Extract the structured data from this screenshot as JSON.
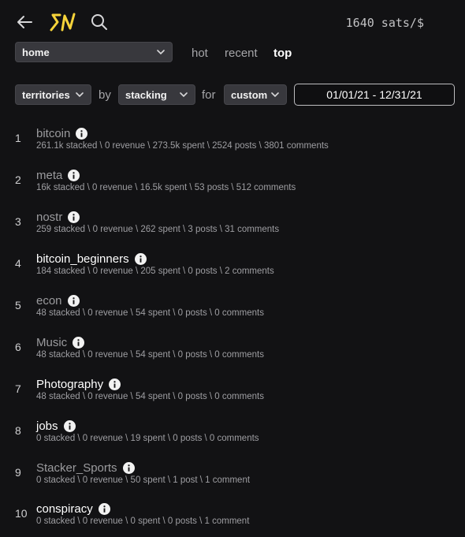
{
  "header": {
    "sats": "1640 sats/$"
  },
  "filters": {
    "sub_select": "home",
    "sort_tabs": [
      "hot",
      "recent",
      "top"
    ],
    "active_tab": "top",
    "what_select": "territories",
    "by_label": "by",
    "by_select": "stacking",
    "for_label": "for",
    "when_select": "custom",
    "date_range": "01/01/21 - 12/31/21"
  },
  "territories": [
    {
      "rank": "1",
      "name": "bitcoin",
      "stats": "261.1k stacked \\ 0 revenue \\ 273.5k spent \\ 2524 posts \\ 3801 comments",
      "style": "dim"
    },
    {
      "rank": "2",
      "name": "meta",
      "stats": "16k stacked \\ 0 revenue \\ 16.5k spent \\ 53 posts \\ 512 comments",
      "style": "dim"
    },
    {
      "rank": "3",
      "name": "nostr",
      "stats": "259 stacked \\ 0 revenue \\ 262 spent \\ 3 posts \\ 31 comments",
      "style": "dim"
    },
    {
      "rank": "4",
      "name": "bitcoin_beginners",
      "stats": "184 stacked \\ 0 revenue \\ 205 spent \\ 0 posts \\ 2 comments",
      "style": "bright"
    },
    {
      "rank": "5",
      "name": "econ",
      "stats": "48 stacked \\ 0 revenue \\ 54 spent \\ 0 posts \\ 0 comments",
      "style": "dim"
    },
    {
      "rank": "6",
      "name": "Music",
      "stats": "48 stacked \\ 0 revenue \\ 54 spent \\ 0 posts \\ 0 comments",
      "style": "dim"
    },
    {
      "rank": "7",
      "name": "Photography",
      "stats": "48 stacked \\ 0 revenue \\ 54 spent \\ 0 posts \\ 0 comments",
      "style": "bright"
    },
    {
      "rank": "8",
      "name": "jobs",
      "stats": "0 stacked \\ 0 revenue \\ 19 spent \\ 0 posts \\ 0 comments",
      "style": "bright"
    },
    {
      "rank": "9",
      "name": "Stacker_Sports",
      "stats": "0 stacked \\ 0 revenue \\ 50 spent \\ 1 post \\ 1 comment",
      "style": "dim"
    },
    {
      "rank": "10",
      "name": "conspiracy",
      "stats": "0 stacked \\ 0 revenue \\ 0 spent \\ 0 posts \\ 1 comment",
      "style": "bright"
    }
  ],
  "icons": {
    "back": "back-arrow-icon",
    "logo": "sn-logo",
    "search": "search-icon",
    "info": "info-icon",
    "chevron": "chevron-down-icon"
  },
  "colors": {
    "background": "#121214",
    "logo": "#f6d33a",
    "select_bg": "#38383d"
  }
}
